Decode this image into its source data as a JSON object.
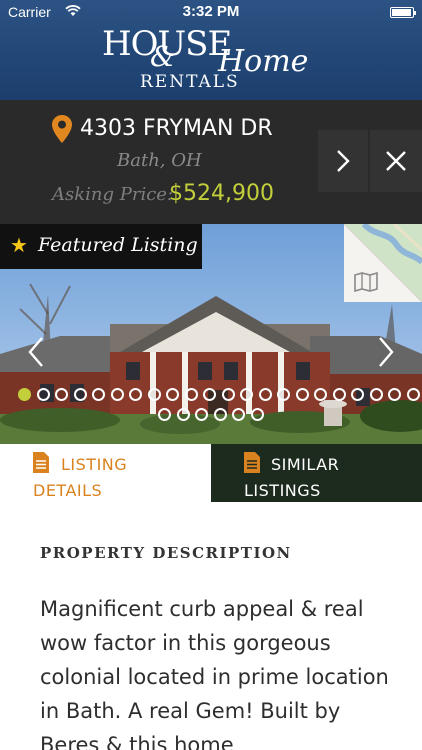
{
  "status_bar": {
    "carrier": "Carrier",
    "time": "3:32 PM"
  },
  "header": {
    "logo_house": "HOUSE",
    "logo_amp": "&",
    "logo_home": "Home",
    "logo_rentals": "RENTALS"
  },
  "listing": {
    "street": "4303 FRYMAN DR",
    "city": "Bath, OH",
    "asking_label": "Asking Price:",
    "asking_price": "$524,900"
  },
  "photo": {
    "featured_label": "Featured Listing",
    "featured_icon": "star-icon",
    "map_icon": "map-icon",
    "photo_count": 28,
    "current_photo": 1
  },
  "tabs": [
    {
      "line1": "LISTING",
      "line2": "DETAILS",
      "icon": "document-icon",
      "active": true
    },
    {
      "line1": "SIMILAR",
      "line2": "LISTINGS",
      "icon": "document-icon",
      "active": false
    }
  ],
  "description": {
    "heading": "PROPERTY DESCRIPTION",
    "body": "Magnificent curb appeal & real wow factor in this gorgeous colonial located in prime location in Bath. A real Gem! Built by Beres & this home"
  },
  "colors": {
    "header_blue": "#1f4677",
    "accent_green": "#c2cf3a",
    "accent_orange": "#d9821e",
    "dark_bar": "#2a2a2a"
  }
}
